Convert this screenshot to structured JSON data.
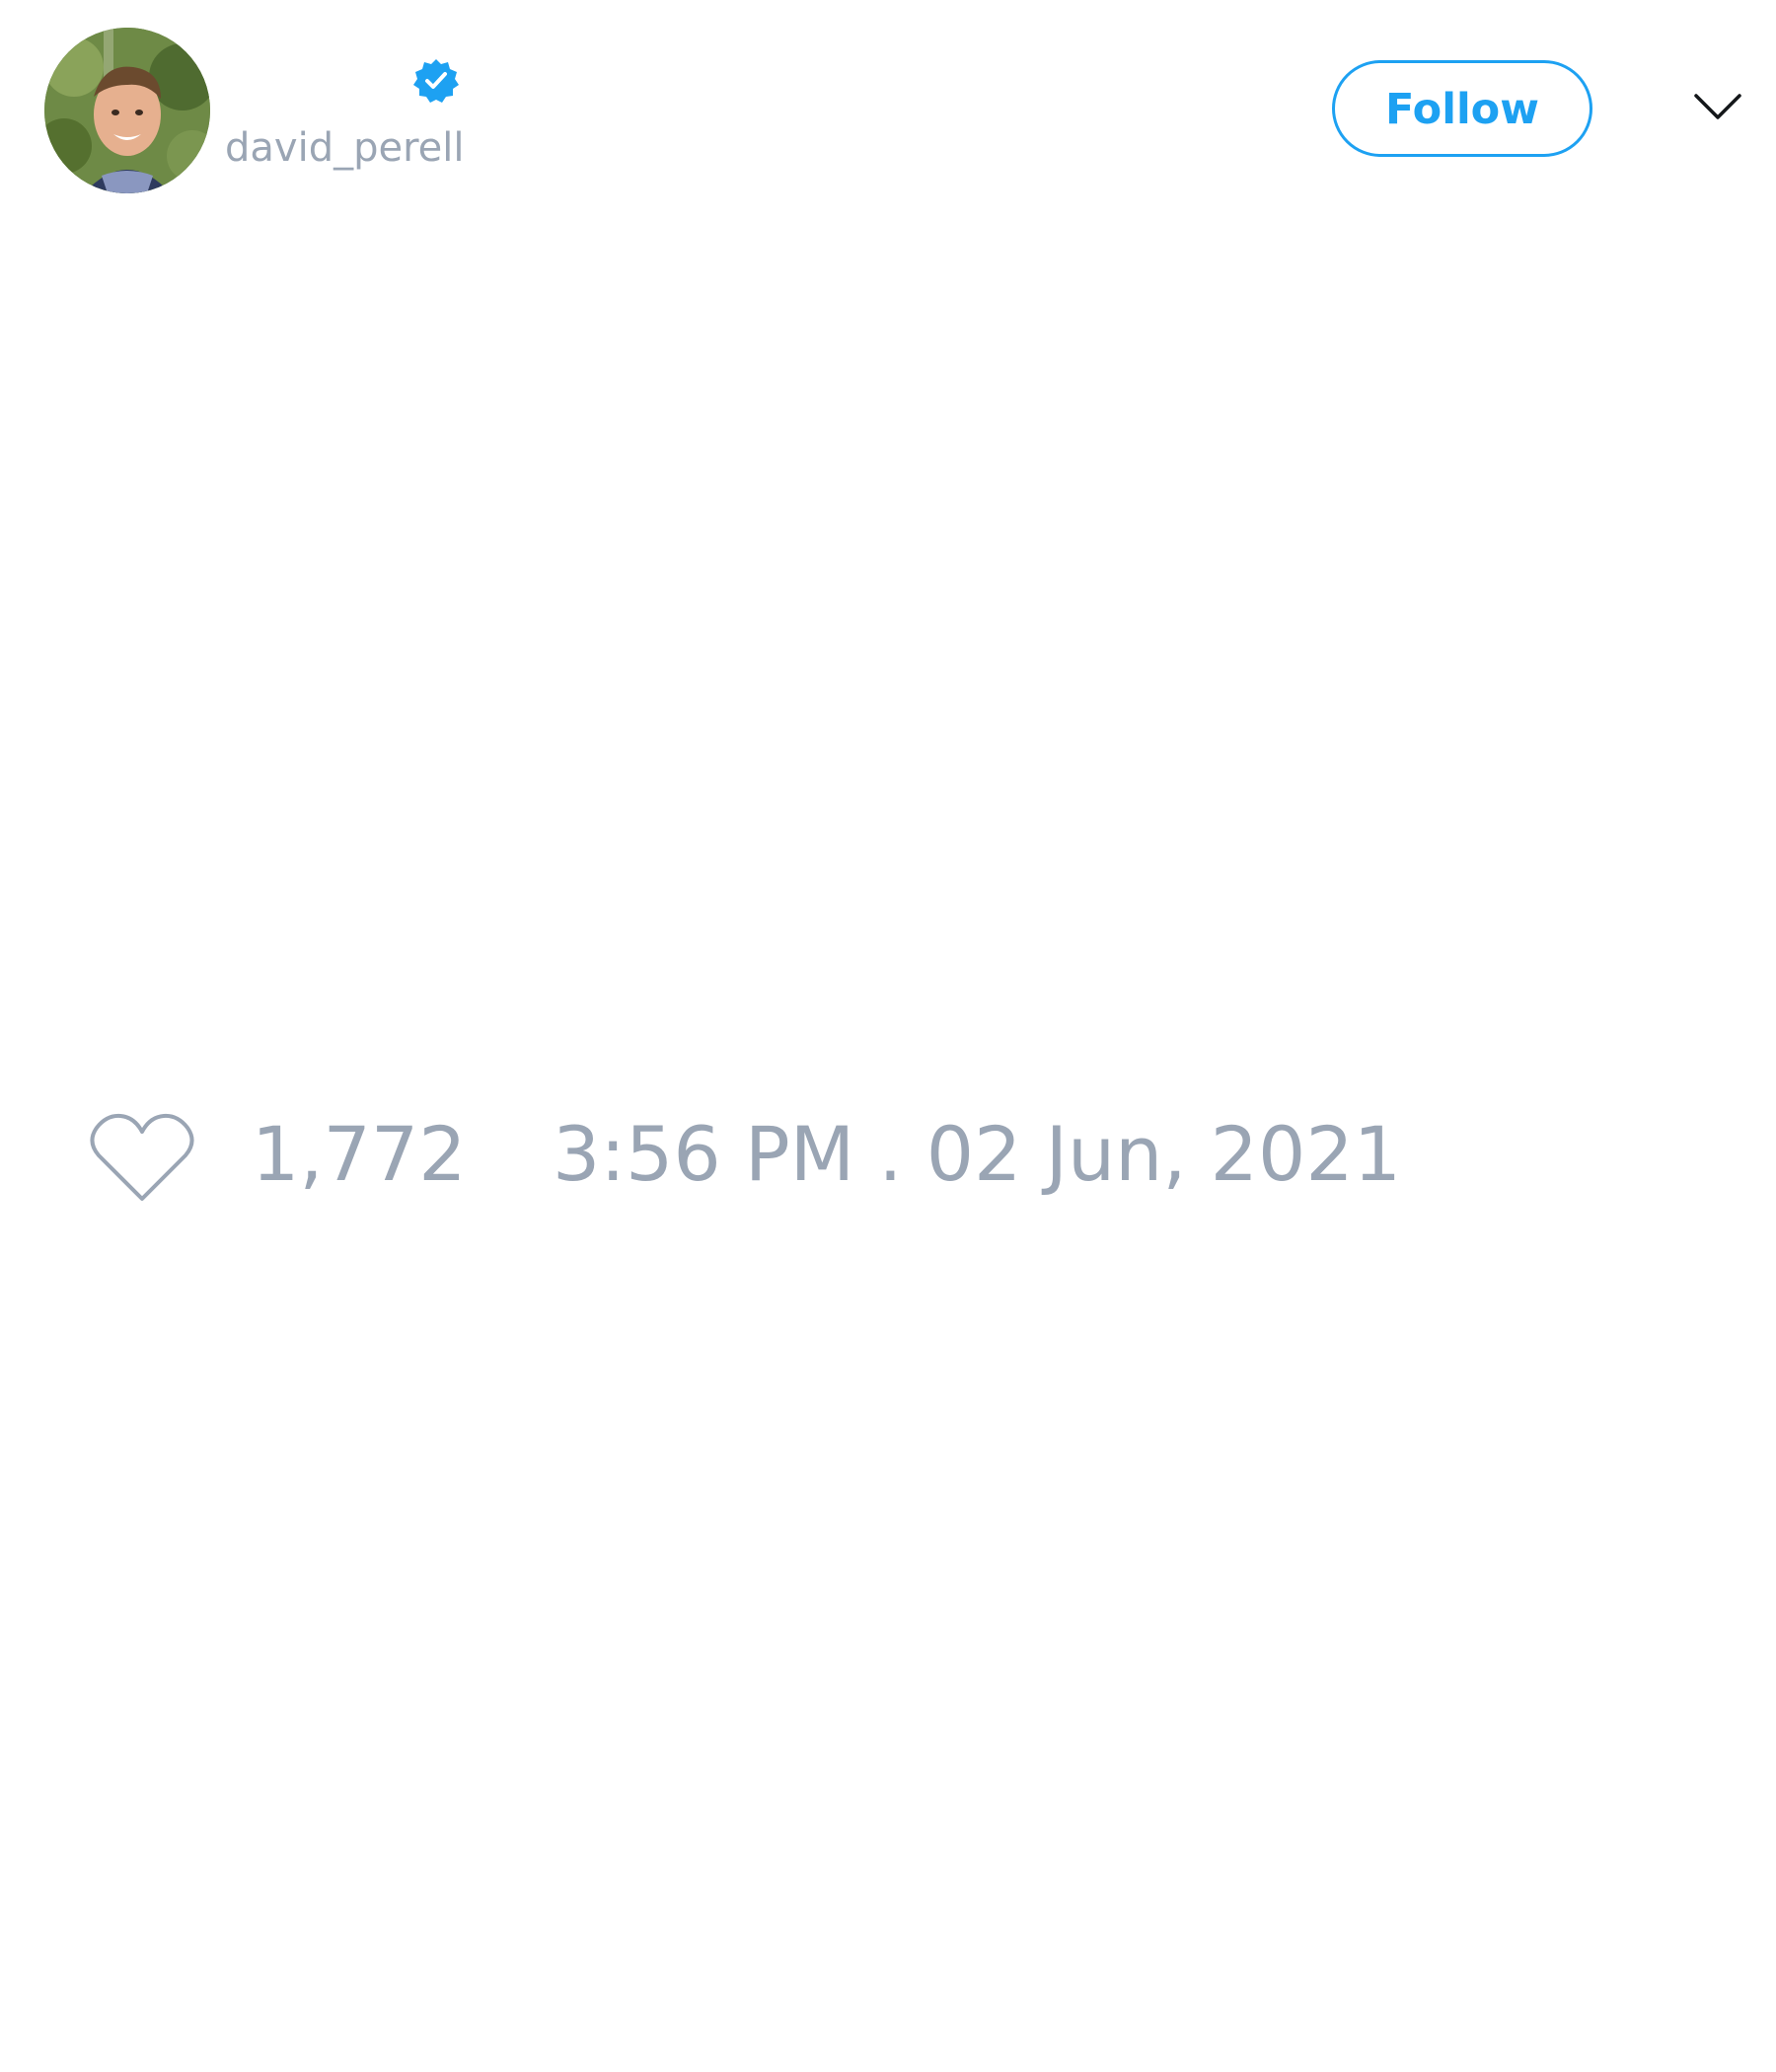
{
  "author": {
    "display_name": "",
    "handle": "david_perell",
    "verified": true,
    "avatar_icon": "profile-photo"
  },
  "actions": {
    "follow_label": "Follow",
    "menu_icon": "chevron-down-icon"
  },
  "footer": {
    "like_icon": "heart-outline-icon",
    "like_count": "1,772",
    "timestamp": "3:56 PM . 02 Jun, 2021"
  },
  "colors": {
    "accent": "#1da1f2",
    "muted_text": "#9aa5b4",
    "background": "#ffffff"
  }
}
